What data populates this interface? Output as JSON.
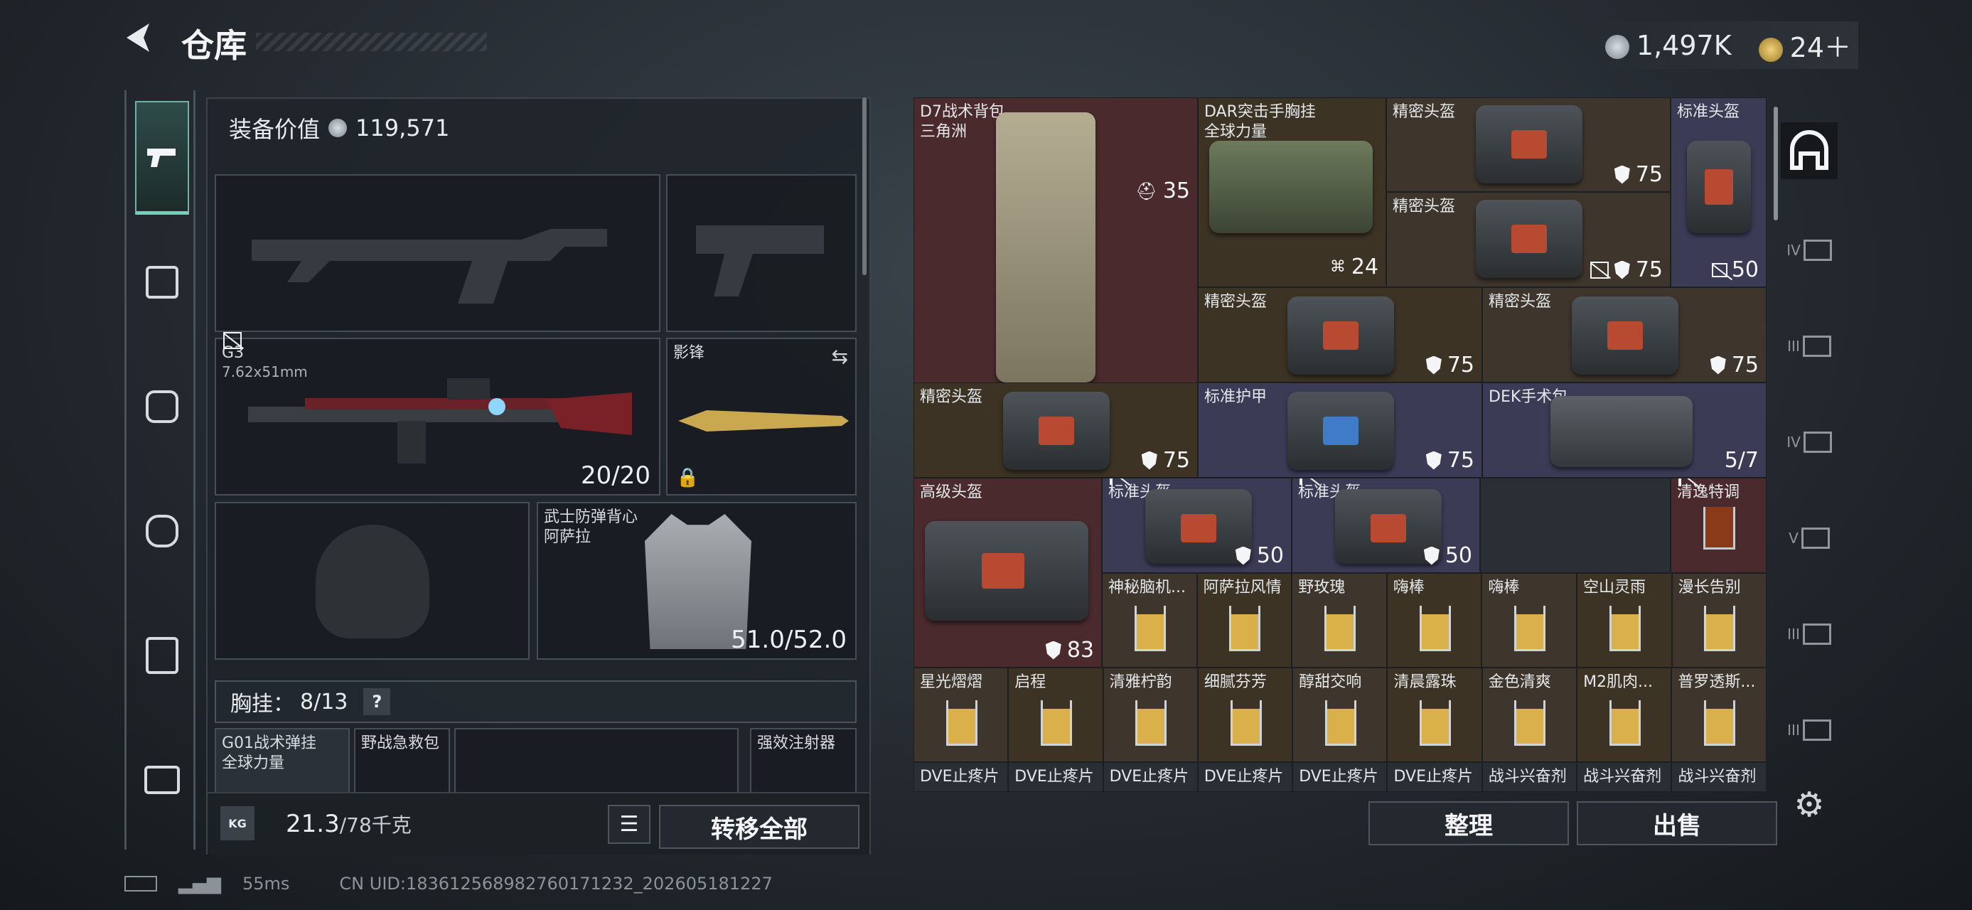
{
  "header": {
    "title": "仓库",
    "currency_1": "1,497K",
    "currency_2": "24＋"
  },
  "left_nav": {
    "items": [
      "pistol-icon",
      "armor-icon",
      "backpack-icon",
      "bag-icon",
      "chest-rig-icon",
      "briefcase-icon"
    ],
    "active": 0
  },
  "equip": {
    "value_label": "装备价值",
    "value": "119,571",
    "primary": {
      "name": "G3",
      "ammo": "7.62x51mm",
      "count": "20/20"
    },
    "melee": {
      "name": "影锋"
    },
    "armor": {
      "name": "武士防弹背心",
      "sub": "阿萨拉",
      "durability": "51.0/52.0"
    },
    "rig": {
      "label": "胸挂：",
      "count": "8/13",
      "help": "?"
    },
    "rig_items": [
      {
        "name": "G01战术弹挂",
        "sub": "全球力量"
      },
      {
        "name": "野战急救包"
      },
      {
        "name": "强效注射器"
      }
    ],
    "weight": "21.3",
    "weight_cap": "/78千克",
    "transfer_all": "转移全部",
    "weight_unit_icon": "KG"
  },
  "stash": {
    "cells": [
      {
        "name": "D7战术背包",
        "sub": "三角洲",
        "val": "35"
      },
      {
        "name": "DAR突击手胸挂",
        "sub": "全球力量",
        "val": "24"
      },
      {
        "name": "精密头盔",
        "val": "75"
      },
      {
        "name": "标准头盔",
        "val": "50"
      },
      {
        "name": "精密头盔",
        "val": "75"
      },
      {
        "name": "精密头盔",
        "val": "75"
      },
      {
        "name": "精密头盔",
        "val": "75"
      },
      {
        "name": "精密头盔",
        "val": "75"
      },
      {
        "name": "标准护甲",
        "val": "75"
      },
      {
        "name": "DEK手术包",
        "val": "5/7"
      },
      {
        "name": "高级头盔",
        "val": "83"
      },
      {
        "name": "标准头盔",
        "val": "50"
      },
      {
        "name": "标准头盔",
        "val": "50"
      },
      {
        "name": "清逸特调"
      },
      {
        "name": "神秘脑机..."
      },
      {
        "name": "阿萨拉风情"
      },
      {
        "name": "野玫瑰"
      },
      {
        "name": "嗨棒"
      },
      {
        "name": "嗨棒"
      },
      {
        "name": "空山灵雨"
      },
      {
        "name": "漫长告别"
      },
      {
        "name": "星光熠熠"
      },
      {
        "name": "启程"
      },
      {
        "name": "清雅柠韵"
      },
      {
        "name": "细腻芬芳"
      },
      {
        "name": "醇甜交响"
      },
      {
        "name": "清晨露珠"
      },
      {
        "name": "金色清爽"
      },
      {
        "name": "M2肌肉..."
      },
      {
        "name": "普罗透斯..."
      },
      {
        "name": "DVE止疼片"
      },
      {
        "name": "DVE止疼片"
      },
      {
        "name": "DVE止疼片"
      },
      {
        "name": "DVE止疼片"
      },
      {
        "name": "DVE止疼片"
      },
      {
        "name": "DVE止疼片"
      },
      {
        "name": "战斗兴奋剂"
      },
      {
        "name": "战斗兴奋剂"
      },
      {
        "name": "战斗兴奋剂"
      }
    ],
    "organize": "整理",
    "sell": "出售"
  },
  "right_tabs": [
    "IV",
    "III",
    "IV",
    "V",
    "III",
    "III"
  ],
  "footer": {
    "ping": "55ms",
    "uid": "CN UID:183612568982760171232_202605181227"
  }
}
